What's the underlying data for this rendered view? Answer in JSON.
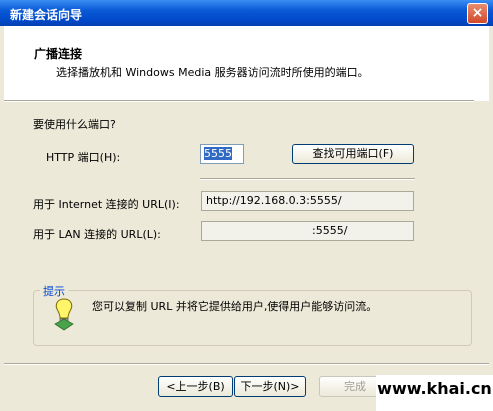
{
  "window": {
    "title": "新建会话向导",
    "close_glyph": "×"
  },
  "header": {
    "title": "广播连接",
    "subtitle": "选择播放机和 Windows Media 服务器访问流时所使用的端口。"
  },
  "question": "要使用什么端口?",
  "http_port": {
    "label": "HTTP 端口(H):",
    "value": "5555",
    "find_button": "查找可用端口(F)"
  },
  "internet_url": {
    "label": "用于 Internet 连接的 URL(I):",
    "value": "http://192.168.0.3:5555/"
  },
  "lan_url": {
    "label": "用于 LAN 连接的 URL(L):",
    "value": ":5555/"
  },
  "hint": {
    "label": "提示",
    "text": "您可以复制 URL 并将它提供给用户,使得用户能够访问流。",
    "icon": "lightbulb-icon"
  },
  "buttons": {
    "back": "<上一步(B)",
    "next": "下一步(N)>",
    "finish": "完成"
  },
  "watermark": "www.khai.cn"
}
